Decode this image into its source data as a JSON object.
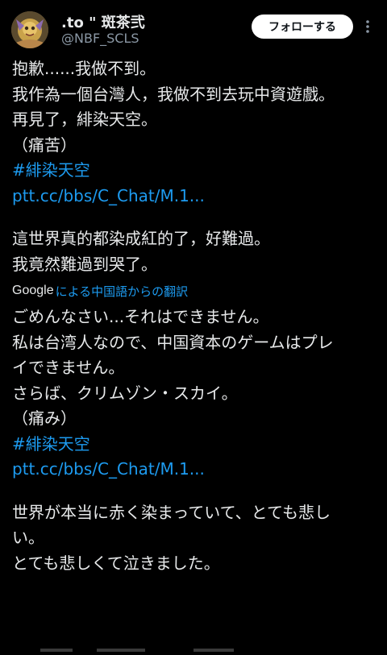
{
  "header": {
    "display_name": ".to \" 斑茶弐",
    "handle": "@NBF_SCLS",
    "follow_label": "フォローする",
    "more_icon": "more-vertical-icon",
    "avatar_icon": "avatar-illustration"
  },
  "colors": {
    "background": "#000000",
    "text": "#e7e9ea",
    "secondary_text": "#8b98a5",
    "link": "#1d9bf0",
    "follow_button_bg": "#ffffff"
  },
  "tweet": {
    "original_lines": [
      "抱歉......我做不到。",
      "我作為一個台灣人，我做不到去玩中資遊戲。",
      "再見了，緋染天空。",
      "（痛苦）"
    ],
    "original_hashtag": "#緋染天空",
    "original_url": "ptt.cc/bbs/C_Chat/M.1...",
    "original_lines_2": [
      "這世界真的都染成紅的了，好難過。",
      "我竟然難過到哭了。"
    ],
    "translate_brand": "Google",
    "translate_label": "による中国語からの翻訳",
    "translated_lines": [
      "ごめんなさい...それはできません。",
      "私は台湾人なので、中国資本のゲームはプレ",
      "イできません。",
      "さらば、クリムゾン・スカイ。",
      "（痛み）"
    ],
    "translated_hashtag": "#緋染天空",
    "translated_url": "ptt.cc/bbs/C_Chat/M.1...",
    "translated_lines_2": [
      "世界が本当に赤く染まっていて、とても悲し",
      "い。",
      "とても悲しくて泣きました。"
    ]
  }
}
